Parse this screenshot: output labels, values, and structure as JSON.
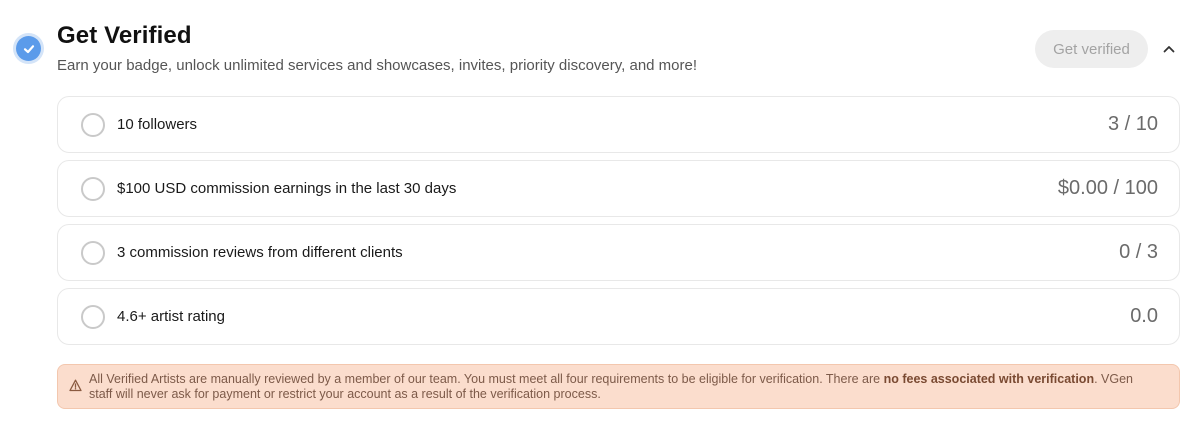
{
  "header": {
    "title": "Get Verified",
    "subtitle": "Earn your badge, unlock unlimited services and showcases, invites, priority discovery, and more!",
    "button_label": "Get verified",
    "icon": "verified-check-icon",
    "collapse_icon": "chevron-up-icon"
  },
  "requirements": [
    {
      "label": "10 followers",
      "progress": "3 / 10",
      "completed": false
    },
    {
      "label": "$100 USD commission earnings in the last 30 days",
      "progress": "$0.00 / 100",
      "completed": false
    },
    {
      "label": "3 commission reviews from different clients",
      "progress": "0 / 3",
      "completed": false
    },
    {
      "label": "4.6+ artist rating",
      "progress": "0.0",
      "completed": false
    }
  ],
  "notice": {
    "icon": "warning-icon",
    "text_before": "All Verified Artists are manually reviewed by a member of our team. You must meet all four requirements to be eligible for verification. There are ",
    "text_bold": "no fees associated with verification",
    "text_after": ". VGen staff will never ask for payment or restrict your account as a result of the verification process."
  },
  "colors": {
    "accent": "#5b9bea",
    "notice_bg": "#fbddcd",
    "button_bg": "#eeeeee",
    "button_text": "#a3a3a3"
  }
}
